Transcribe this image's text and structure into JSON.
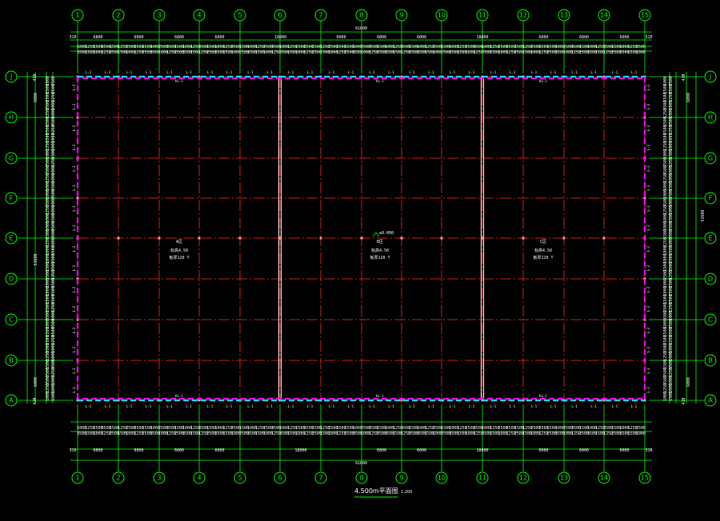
{
  "colors": {
    "background": "#000000",
    "axis": "#00ff00",
    "grid": "#ff2a2a",
    "outline_a": "#ff00ff",
    "outline_b": "#00e5ff",
    "text": "#ffffff"
  },
  "column_axes": {
    "labels": [
      "1",
      "2",
      "3",
      "4",
      "5",
      "6",
      "7",
      "8",
      "9",
      "10",
      "11",
      "12",
      "13",
      "14",
      "15"
    ],
    "spacings": [
      "6800",
      "6000",
      "6800",
      "6000",
      "",
      "",
      "6800",
      "",
      "",
      "",
      "6000",
      "6800",
      "6000"
    ],
    "segments": [
      {
        "label": "6800",
        "from": 0,
        "to": 1
      },
      {
        "label": "6000",
        "from": 1,
        "to": 2
      },
      {
        "label": "6800",
        "from": 2,
        "to": 3
      },
      {
        "label": "6000",
        "from": 3,
        "to": 4
      },
      {
        "label": "18000",
        "from": 4,
        "to": 6
      },
      {
        "label": "6000",
        "from": 6,
        "to": 7
      },
      {
        "label": "6800",
        "from": 7,
        "to": 8
      },
      {
        "label": "6000",
        "from": 8,
        "to": 9
      },
      {
        "label": "18000",
        "from": 9,
        "to": 11
      },
      {
        "label": "6000",
        "from": 11,
        "to": 12
      },
      {
        "label": "6800",
        "from": 12,
        "to": 13
      },
      {
        "label": "6000",
        "from": 13,
        "to": 14
      }
    ],
    "bottom_segments": [
      {
        "label": "6800",
        "from": 0,
        "to": 1
      },
      {
        "label": "6000",
        "from": 1,
        "to": 2
      },
      {
        "label": "6800",
        "from": 2,
        "to": 3
      },
      {
        "label": "6000",
        "from": 3,
        "to": 4
      },
      {
        "label": "18000",
        "from": 4,
        "to": 7
      },
      {
        "label": "6800",
        "from": 7,
        "to": 8
      },
      {
        "label": "6000",
        "from": 8,
        "to": 9
      },
      {
        "label": "18000",
        "from": 9,
        "to": 11
      },
      {
        "label": "6000",
        "from": 11,
        "to": 12
      },
      {
        "label": "6800",
        "from": 12,
        "to": 13
      },
      {
        "label": "6000",
        "from": 13,
        "to": 14
      }
    ],
    "end_offset": "310",
    "total": "91600",
    "sub_row": [
      "1000",
      "1250",
      "2500",
      "3500",
      "1500",
      "1000",
      "1250",
      "2500",
      "3500",
      "1500"
    ]
  },
  "row_axes": {
    "labels": [
      "J",
      "H",
      "G",
      "F",
      "E",
      "D",
      "C",
      "B",
      "A"
    ],
    "left_outer": "6000",
    "left_total": "53600",
    "right_outer": "6000",
    "right_total": "53600",
    "end_offset": "410",
    "sub_col": [
      "1000",
      "1500",
      "2500",
      "3500",
      "1250",
      "1000"
    ]
  },
  "plan": {
    "zones": [
      {
        "name": "A区",
        "line1": "标高4.50",
        "line2": "板厚120 T"
      },
      {
        "name": "B区",
        "line1": "标高4.50",
        "line2": "板厚120 T"
      },
      {
        "name": "C区",
        "line1": "标高4.50",
        "line2": "板厚120 T"
      }
    ],
    "elevation_mark": "±0.000",
    "edge_tag": "L-1",
    "beam_tag": "KL-1",
    "side_tag": "L-2"
  },
  "title": {
    "text": "4.500m平面图",
    "scale": "1:200"
  }
}
